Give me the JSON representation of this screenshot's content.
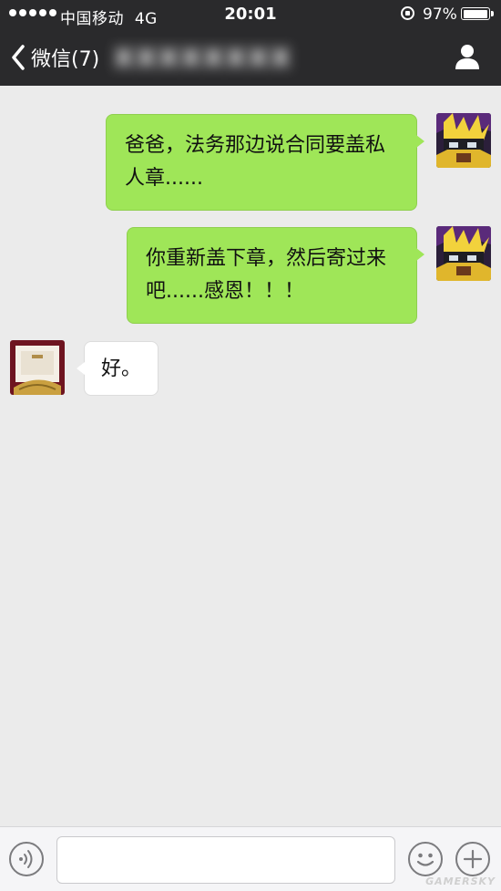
{
  "status_bar": {
    "carrier": "中国移动",
    "network": "4G",
    "time": "20:01",
    "battery_percent": "97%",
    "battery_level": 0.97
  },
  "nav": {
    "back_label": "微信(7)",
    "contact_name_obscured": "XXXXXXXX"
  },
  "messages": [
    {
      "sender": "me",
      "text": "爸爸，法务那边说合同要盖私人章......"
    },
    {
      "sender": "me",
      "text": "你重新盖下章，然后寄过来吧......感恩！！！"
    },
    {
      "sender": "them",
      "text": "好。"
    }
  ],
  "input": {
    "placeholder": ""
  },
  "watermark": "GAMERSKY",
  "colors": {
    "nav_background": "#2a2a2c",
    "chat_background": "#ebebeb",
    "my_bubble": "#9fe658",
    "their_bubble": "#ffffff"
  }
}
